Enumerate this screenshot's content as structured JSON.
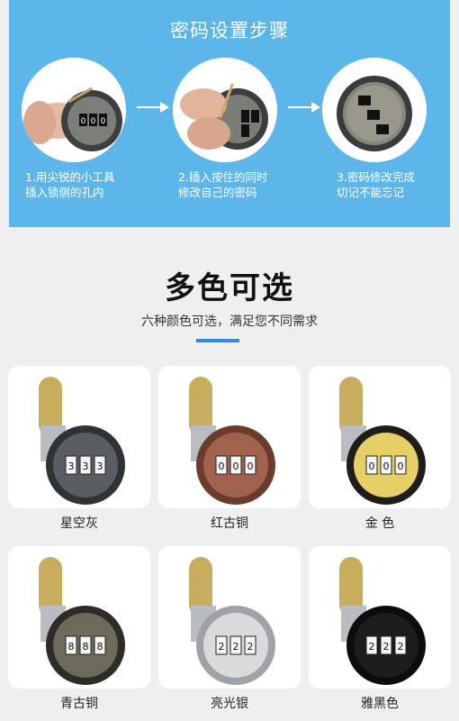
{
  "steps": {
    "title": "密码设置步骤",
    "items": [
      {
        "line1": "1.用尖锐的小工具",
        "line2": "插入锁侧的孔内"
      },
      {
        "line1": "2.插入按住的同时",
        "line2": "修改自己的密码"
      },
      {
        "line1": "3.密码修改完成",
        "line2": "切记不能忘记"
      }
    ],
    "dial_digits": [
      "0",
      "0",
      "0"
    ]
  },
  "section": {
    "title": "多色可选",
    "subtitle": "六种颜色可选，满足您不同需求",
    "accent": "#2a8ee6"
  },
  "products": [
    {
      "name": "星空灰",
      "color": "#5a5d62",
      "rim": "#2f3236",
      "digits": [
        "3",
        "3",
        "3"
      ]
    },
    {
      "name": "红古铜",
      "color": "#a0624d",
      "rim": "#6b3b2c",
      "digits": [
        "0",
        "0",
        "0"
      ]
    },
    {
      "name": "金 色",
      "color": "#e7cf67",
      "rim": "#1e1d1a",
      "digits": [
        "0",
        "0",
        "0"
      ]
    },
    {
      "name": "青古铜",
      "color": "#6d6a5c",
      "rim": "#2d2c28",
      "digits": [
        "8",
        "8",
        "8"
      ]
    },
    {
      "name": "亮光银",
      "color": "#d9dadc",
      "rim": "#9fa2a6",
      "digits": [
        "2",
        "2",
        "2"
      ]
    },
    {
      "name": "雅黑色",
      "color": "#1c1c1c",
      "rim": "#0c0c0c",
      "digits": [
        "2",
        "2",
        "2"
      ]
    }
  ]
}
